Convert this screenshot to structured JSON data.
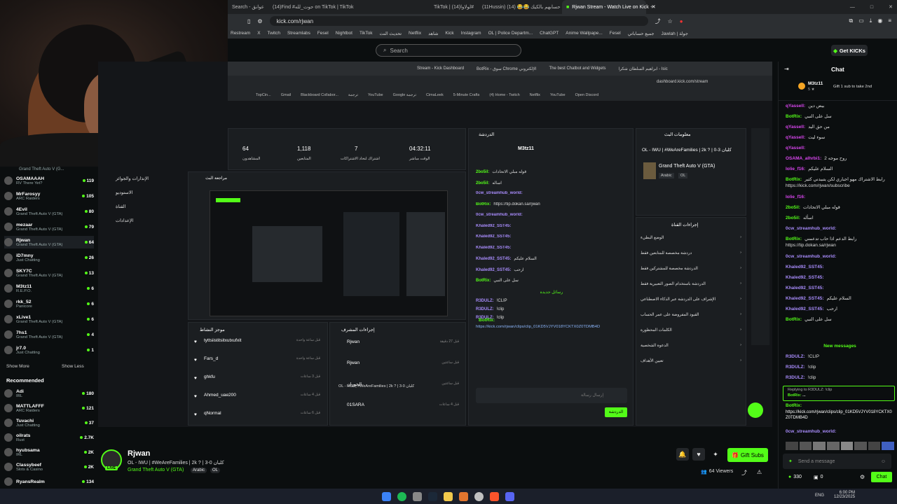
{
  "browser": {
    "tabs": [
      {
        "label": "Search - عوانق"
      },
      {
        "label": "(14)Find #حوت_لله on TikTok | TikTok"
      },
      {
        "label": "TikTok | (14)لولاوا#"
      },
      {
        "label": "(11Hussin) حسابهم بالكيك 😂😂 (14)"
      },
      {
        "label": "Rjwan Stream - Watch Live on Kick",
        "active": true
      }
    ],
    "url": "kick.com/rjwan",
    "bookmarks": [
      "Restream",
      "X",
      "Twitch",
      "Streamlabs",
      "Fesel",
      "Nightbot",
      "TikTok",
      "تحديث النت",
      "Netflix",
      "شاهد",
      "Kick",
      "Instagram",
      "OL | Police Departm...",
      "ChatGPT",
      "Anime Wallpape...",
      "Fesel",
      "جميع حساباتي",
      "Jawlah | جولة"
    ]
  },
  "kick_header": {
    "search_placeholder": "Search",
    "get_kicks": "Get KICKs"
  },
  "sidebar": {
    "following": [
      {
        "name": "OSAMAAAH",
        "category": "RV There Yet?",
        "viewers": "119"
      },
      {
        "name": "MrFarosyy",
        "category": "ARC Raiders",
        "viewers": "105"
      },
      {
        "name": "4Evil",
        "category": "Grand Theft Auto V (GTA)",
        "viewers": "80"
      },
      {
        "name": "mezaar",
        "category": "Grand Theft Auto V (GTA)",
        "viewers": "79"
      },
      {
        "name": "Rjwan",
        "category": "Grand Theft Auto V (GTA)",
        "viewers": "64"
      },
      {
        "name": "iD7mny",
        "category": "Just Chatting",
        "viewers": "26"
      },
      {
        "name": "SKY7C",
        "category": "Grand Theft Auto V (GTA)",
        "viewers": "13"
      },
      {
        "name": "M3tz11",
        "category": "R.E.P.O.",
        "viewers": "6"
      },
      {
        "name": "rkk_52",
        "category": "Panicore",
        "viewers": "6"
      },
      {
        "name": "xLive1",
        "category": "Grand Theft Auto V (GTA)",
        "viewers": "6"
      },
      {
        "name": "7hs1",
        "category": "Grand Theft Auto V (GTA)",
        "viewers": "4"
      },
      {
        "name": "jr7.0",
        "category": "Just Chatting",
        "viewers": "1"
      }
    ],
    "first_category": "Grand Theft Auto V (G...",
    "show_more": "Show More",
    "show_less": "Show Less",
    "recommended_title": "Recommended",
    "recommended": [
      {
        "name": "Adi",
        "category": "IRL",
        "viewers": "180"
      },
      {
        "name": "MATTLAFFF",
        "category": "ARC Raiders",
        "viewers": "121"
      },
      {
        "name": "Tuvachi",
        "category": "Just Chatting",
        "viewers": "37"
      },
      {
        "name": "oilrats",
        "category": "Rust",
        "viewers": "2.7K"
      },
      {
        "name": "hyubsama",
        "category": "IRL",
        "viewers": "2K"
      },
      {
        "name": "Classybeef",
        "category": "Slots & Casino",
        "viewers": "2K"
      },
      {
        "name": "RyansRealm",
        "category": "",
        "viewers": "134"
      }
    ]
  },
  "video": {
    "dash_tabs": [
      "Stream - Kick Dashboard",
      "BotRix - سوق Chrome الإلكتروني",
      "The best Chatbot and Widgets",
      "ابراهيم السلطان شكرا - Isic"
    ],
    "dash_url": "dashboard.kick.com/stream",
    "dash_bookmarks": [
      "TopCin...",
      "Gmail",
      "Blackboard Collabor...",
      "ترجمة",
      "YouTube",
      "Google ترجمة",
      "CimaLeek",
      "5-Minute Crafts",
      "(4) Home - Twitch",
      "Netflix",
      "YouTube",
      "Open Discord"
    ],
    "stats": [
      {
        "value": "64",
        "label": "المشاهدون"
      },
      {
        "value": "1,118",
        "label": "المتابعين"
      },
      {
        "value": "7",
        "label": "اشتراك لنحاد الاشتراكات"
      },
      {
        "value": "04:32:11",
        "label": "الوقت مباشر"
      }
    ],
    "left_menu": [
      "الإنذارات والجوائز",
      "الاستوديو",
      "القناة",
      "الإعدادات"
    ],
    "preview_title": "مراجعة البث",
    "activity_title": "موجز النشاط",
    "activity_items": [
      {
        "name": "tyttsiistitsitxutxufxit",
        "time": "قبل ساعة واحدة"
      },
      {
        "name": "Fars_d",
        "time": "قبل ساعة واحدة"
      },
      {
        "name": "ghkfu",
        "time": "قبل 3 ساعات"
      },
      {
        "name": "Ahmed_uae200",
        "time": "قبل 4 ساعات"
      },
      {
        "name": "qNormal",
        "time": "قبل 6 ساعات"
      }
    ],
    "mod_title": "إجراءات المشرف",
    "mod_items": [
      {
        "name": "Rjwan",
        "time": "قبل 27 دقيقة"
      },
      {
        "name": "Rjwan",
        "time": "قبل ساعتين"
      },
      {
        "name": "الحوران",
        "time": "قبل ساعتين"
      },
      {
        "name": "01SARA",
        "time": "قبل 4 ساعات"
      }
    ],
    "mod_title_text": "ОL - IWU | #WeAreFamilies | 2k ? | كلبان 0-3",
    "dash_chat_title": "الدردشة",
    "dash_chat_user": "M3tz11",
    "dash_chat_messages": [
      {
        "user": "2bo5il:",
        "text": "قوله مبلي الاتحادات",
        "color": "green"
      },
      {
        "user": "2bo5il:",
        "text": "اسأله",
        "color": "green"
      },
      {
        "user": "0cw_streamhub_world:",
        "text": "",
        "color": "purple"
      },
      {
        "user": "BotRix:",
        "text": "https://tip.dokan.sa/rjwan",
        "color": "green"
      },
      {
        "user": "0cw_streamhub_world:",
        "text": "",
        "color": "purple"
      },
      {
        "user": "Khaled92_SST45:",
        "text": "",
        "color": "purple"
      },
      {
        "user": "Khaled92_SST45:",
        "text": "",
        "color": "purple"
      },
      {
        "user": "Khaled92_SST45:",
        "text": "",
        "color": "purple"
      },
      {
        "user": "Khaled92_SST45:",
        "text": "السلام عليكم",
        "color": "purple"
      },
      {
        "user": "Khaled92_SST45:",
        "text": "ارحب",
        "color": "purple"
      },
      {
        "user": "BotRix:",
        "text": "سل على النبي",
        "color": "green"
      }
    ],
    "new_messages": "رسائل جديدة",
    "dash_new_messages": [
      {
        "user": "R3DULZ:",
        "text": "!CLIP"
      },
      {
        "user": "R3DULZ:",
        "text": "!clip"
      },
      {
        "user": "R3DULZ:",
        "text": "!clip"
      }
    ],
    "dash_send": "الدردشة",
    "dash_send_placeholder": "إرسال رسالة",
    "right_panel_title": "معلومات البث",
    "right_stream_title": "ОL - IWU | #WeAreFamilies | 2k ? | كلبان 3-0",
    "right_game": "Grand Theft Auto V (GTA)",
    "right_tags": [
      "Arabic",
      "OL"
    ],
    "actions_title": "إجراءات القناة",
    "actions": [
      "الوضع البطيء",
      "دردشة مخصصة للمتابعين فقط",
      "الدردشة مخصصة للمشتركين فقط",
      "الدردشة باستخدام الصور التعبيرية فقط",
      "الإشراف على الدردشة عبر الذكاء الاصطناعي",
      "القيود المفروضة على عمر الحساب",
      "الكلمات المحظورة",
      "الدعوة الشخصية",
      "تعيين الأهداف"
    ],
    "taskbar_time": "١٢/٢٣/٢٠٢٥"
  },
  "stream_info": {
    "channel": "Rjwan",
    "title": "ОL - IWU | #WeAreFamilies | 2k ? | كلبان 0-3",
    "category": "Grand Theft Auto V (GTA)",
    "tags": [
      "Arabic",
      "OL"
    ],
    "live_badge": "LIVE",
    "viewers": "64 Viewers",
    "gift_subs": "Gift Subs"
  },
  "chat": {
    "title": "Chat",
    "pinned_user": "M3tz11",
    "pinned_sub": "5 ★",
    "gift_banner": "Gift 1 sub to take 2nd",
    "messages": [
      {
        "user": "qYassell:",
        "text": "بيض دين",
        "ucolor": "#d946ef"
      },
      {
        "user": "BotRix:",
        "text": "سل على النبي",
        "ucolor": "#53fc18"
      },
      {
        "user": "qYassell:",
        "text": "من حق اليد",
        "ucolor": "#d946ef"
      },
      {
        "user": "qYassell:",
        "text": "سوء ليت",
        "ucolor": "#d946ef"
      },
      {
        "user": "qYassell:",
        "text": "",
        "ucolor": "#d946ef"
      },
      {
        "user": "OSAMA_alhrbi1:",
        "text": "روح موجه 2",
        "ucolor": "#d946ef"
      },
      {
        "user": "lolie_f16:",
        "text": "السلام عليكم",
        "ucolor": "#d946ef"
      },
      {
        "user": "BotRix:",
        "text": "رابط الاشتراك مهو اجباري لكن يتبيدني كثير https://kick.com/rjwan/subscribe",
        "ucolor": "#53fc18"
      },
      {
        "user": "lolie_f16:",
        "text": "",
        "ucolor": "#d946ef"
      },
      {
        "user": "2bo5il:",
        "text": "قوله مبلي الاتحادات",
        "ucolor": "#53fc18"
      },
      {
        "user": "2bo5il:",
        "text": "اسأله",
        "ucolor": "#53fc18"
      },
      {
        "user": "0cw_streamhub_world:",
        "text": "",
        "ucolor": "#a78bfa"
      },
      {
        "user": "BotRix:",
        "text": "رابط الدعم اذا حاب تدعمني https://tip.dokan.sa/rjwan",
        "ucolor": "#53fc18"
      },
      {
        "user": "0cw_streamhub_world:",
        "text": "",
        "ucolor": "#a78bfa"
      },
      {
        "user": "Khaled92_SST45:",
        "text": "",
        "ucolor": "#a78bfa"
      },
      {
        "user": "Khaled92_SST45:",
        "text": "",
        "ucolor": "#a78bfa"
      },
      {
        "user": "Khaled92_SST45:",
        "text": "",
        "ucolor": "#a78bfa"
      },
      {
        "user": "Khaled92_SST45:",
        "text": "السلام عليكم",
        "ucolor": "#a78bfa"
      },
      {
        "user": "Khaled92_SST45:",
        "text": "ارحب",
        "ucolor": "#a78bfa"
      },
      {
        "user": "BotRix:",
        "text": "سل على النبي",
        "ucolor": "#53fc18"
      }
    ],
    "new_messages": "New messages",
    "new": [
      {
        "user": "R3DULZ:",
        "text": "!CLIP"
      },
      {
        "user": "R3DULZ:",
        "text": "!clip"
      },
      {
        "user": "R3DULZ:",
        "text": "!clip"
      }
    ],
    "reply_label": "Replying to R3DULZ: !clip",
    "reply_user": "BotRix:",
    "reply_text": "...",
    "botrix_clip_user": "BotRix:",
    "botrix_clip": "https://kick.com/rjwan/clips/clip_01KD5VJYV018YCKTX0Z0TDMB4D",
    "last_user": "0cw_streamhub_world:",
    "input_placeholder": "Send a message",
    "points": "330",
    "bottom_count": "0",
    "chat_button": "Chat"
  },
  "taskbar": {
    "lang": "ENG",
    "time": "6:00 PM",
    "date": "12/23/2025"
  },
  "colors": {
    "kick_green": "#53fc18",
    "bg": "#0b0e0f"
  }
}
